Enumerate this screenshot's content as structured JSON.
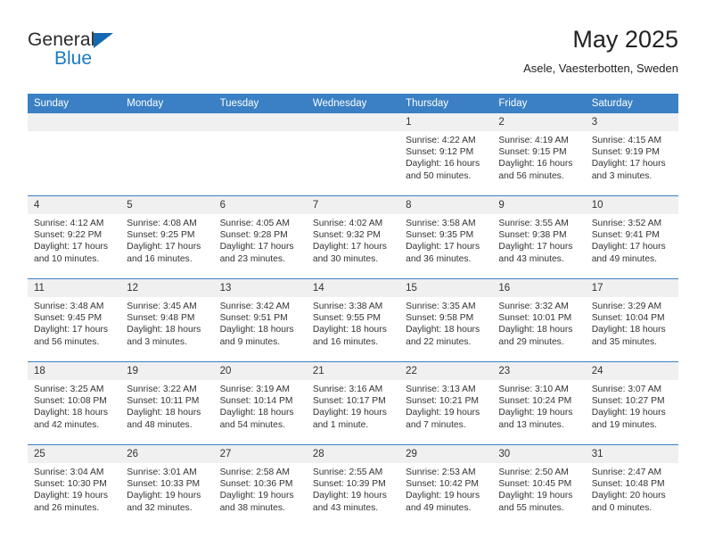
{
  "brand": {
    "name_primary": "General",
    "name_secondary": "Blue"
  },
  "header": {
    "title": "May 2025",
    "subtitle": "Asele, Vaesterbotten, Sweden"
  },
  "colors": {
    "header_blue": "#3b80c4",
    "logo_blue": "#1a7ac4",
    "daynum_band": "#f0f0f0",
    "text": "#333333"
  },
  "weekday_headers": [
    "Sunday",
    "Monday",
    "Tuesday",
    "Wednesday",
    "Thursday",
    "Friday",
    "Saturday"
  ],
  "weeks": [
    [
      {
        "day": "",
        "lines": [
          "",
          "",
          "",
          ""
        ]
      },
      {
        "day": "",
        "lines": [
          "",
          "",
          "",
          ""
        ]
      },
      {
        "day": "",
        "lines": [
          "",
          "",
          "",
          ""
        ]
      },
      {
        "day": "",
        "lines": [
          "",
          "",
          "",
          ""
        ]
      },
      {
        "day": "1",
        "lines": [
          "Sunrise: 4:22 AM",
          "Sunset: 9:12 PM",
          "Daylight: 16 hours",
          "and 50 minutes."
        ]
      },
      {
        "day": "2",
        "lines": [
          "Sunrise: 4:19 AM",
          "Sunset: 9:15 PM",
          "Daylight: 16 hours",
          "and 56 minutes."
        ]
      },
      {
        "day": "3",
        "lines": [
          "Sunrise: 4:15 AM",
          "Sunset: 9:19 PM",
          "Daylight: 17 hours",
          "and 3 minutes."
        ]
      }
    ],
    [
      {
        "day": "4",
        "lines": [
          "Sunrise: 4:12 AM",
          "Sunset: 9:22 PM",
          "Daylight: 17 hours",
          "and 10 minutes."
        ]
      },
      {
        "day": "5",
        "lines": [
          "Sunrise: 4:08 AM",
          "Sunset: 9:25 PM",
          "Daylight: 17 hours",
          "and 16 minutes."
        ]
      },
      {
        "day": "6",
        "lines": [
          "Sunrise: 4:05 AM",
          "Sunset: 9:28 PM",
          "Daylight: 17 hours",
          "and 23 minutes."
        ]
      },
      {
        "day": "7",
        "lines": [
          "Sunrise: 4:02 AM",
          "Sunset: 9:32 PM",
          "Daylight: 17 hours",
          "and 30 minutes."
        ]
      },
      {
        "day": "8",
        "lines": [
          "Sunrise: 3:58 AM",
          "Sunset: 9:35 PM",
          "Daylight: 17 hours",
          "and 36 minutes."
        ]
      },
      {
        "day": "9",
        "lines": [
          "Sunrise: 3:55 AM",
          "Sunset: 9:38 PM",
          "Daylight: 17 hours",
          "and 43 minutes."
        ]
      },
      {
        "day": "10",
        "lines": [
          "Sunrise: 3:52 AM",
          "Sunset: 9:41 PM",
          "Daylight: 17 hours",
          "and 49 minutes."
        ]
      }
    ],
    [
      {
        "day": "11",
        "lines": [
          "Sunrise: 3:48 AM",
          "Sunset: 9:45 PM",
          "Daylight: 17 hours",
          "and 56 minutes."
        ]
      },
      {
        "day": "12",
        "lines": [
          "Sunrise: 3:45 AM",
          "Sunset: 9:48 PM",
          "Daylight: 18 hours",
          "and 3 minutes."
        ]
      },
      {
        "day": "13",
        "lines": [
          "Sunrise: 3:42 AM",
          "Sunset: 9:51 PM",
          "Daylight: 18 hours",
          "and 9 minutes."
        ]
      },
      {
        "day": "14",
        "lines": [
          "Sunrise: 3:38 AM",
          "Sunset: 9:55 PM",
          "Daylight: 18 hours",
          "and 16 minutes."
        ]
      },
      {
        "day": "15",
        "lines": [
          "Sunrise: 3:35 AM",
          "Sunset: 9:58 PM",
          "Daylight: 18 hours",
          "and 22 minutes."
        ]
      },
      {
        "day": "16",
        "lines": [
          "Sunrise: 3:32 AM",
          "Sunset: 10:01 PM",
          "Daylight: 18 hours",
          "and 29 minutes."
        ]
      },
      {
        "day": "17",
        "lines": [
          "Sunrise: 3:29 AM",
          "Sunset: 10:04 PM",
          "Daylight: 18 hours",
          "and 35 minutes."
        ]
      }
    ],
    [
      {
        "day": "18",
        "lines": [
          "Sunrise: 3:25 AM",
          "Sunset: 10:08 PM",
          "Daylight: 18 hours",
          "and 42 minutes."
        ]
      },
      {
        "day": "19",
        "lines": [
          "Sunrise: 3:22 AM",
          "Sunset: 10:11 PM",
          "Daylight: 18 hours",
          "and 48 minutes."
        ]
      },
      {
        "day": "20",
        "lines": [
          "Sunrise: 3:19 AM",
          "Sunset: 10:14 PM",
          "Daylight: 18 hours",
          "and 54 minutes."
        ]
      },
      {
        "day": "21",
        "lines": [
          "Sunrise: 3:16 AM",
          "Sunset: 10:17 PM",
          "Daylight: 19 hours",
          "and 1 minute."
        ]
      },
      {
        "day": "22",
        "lines": [
          "Sunrise: 3:13 AM",
          "Sunset: 10:21 PM",
          "Daylight: 19 hours",
          "and 7 minutes."
        ]
      },
      {
        "day": "23",
        "lines": [
          "Sunrise: 3:10 AM",
          "Sunset: 10:24 PM",
          "Daylight: 19 hours",
          "and 13 minutes."
        ]
      },
      {
        "day": "24",
        "lines": [
          "Sunrise: 3:07 AM",
          "Sunset: 10:27 PM",
          "Daylight: 19 hours",
          "and 19 minutes."
        ]
      }
    ],
    [
      {
        "day": "25",
        "lines": [
          "Sunrise: 3:04 AM",
          "Sunset: 10:30 PM",
          "Daylight: 19 hours",
          "and 26 minutes."
        ]
      },
      {
        "day": "26",
        "lines": [
          "Sunrise: 3:01 AM",
          "Sunset: 10:33 PM",
          "Daylight: 19 hours",
          "and 32 minutes."
        ]
      },
      {
        "day": "27",
        "lines": [
          "Sunrise: 2:58 AM",
          "Sunset: 10:36 PM",
          "Daylight: 19 hours",
          "and 38 minutes."
        ]
      },
      {
        "day": "28",
        "lines": [
          "Sunrise: 2:55 AM",
          "Sunset: 10:39 PM",
          "Daylight: 19 hours",
          "and 43 minutes."
        ]
      },
      {
        "day": "29",
        "lines": [
          "Sunrise: 2:53 AM",
          "Sunset: 10:42 PM",
          "Daylight: 19 hours",
          "and 49 minutes."
        ]
      },
      {
        "day": "30",
        "lines": [
          "Sunrise: 2:50 AM",
          "Sunset: 10:45 PM",
          "Daylight: 19 hours",
          "and 55 minutes."
        ]
      },
      {
        "day": "31",
        "lines": [
          "Sunrise: 2:47 AM",
          "Sunset: 10:48 PM",
          "Daylight: 20 hours",
          "and 0 minutes."
        ]
      }
    ]
  ]
}
